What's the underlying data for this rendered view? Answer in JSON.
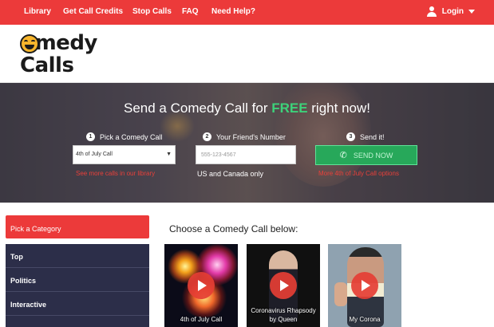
{
  "nav": {
    "links": [
      "Library",
      "Get Call Credits",
      "Stop Calls",
      "FAQ",
      "Need Help?"
    ],
    "login_label": "Login"
  },
  "logo": {
    "line1": "medy",
    "line2": "Calls",
    "first_letter": "C"
  },
  "hero": {
    "title_before": "Send a Comedy Call for ",
    "title_free": "FREE",
    "title_after": " right now!",
    "steps": [
      {
        "num": "1",
        "label": "Pick a Comedy Call"
      },
      {
        "num": "2",
        "label": "Your Friend's Number"
      },
      {
        "num": "3",
        "label": "Send it!"
      }
    ],
    "selected_call": "4th of July Call",
    "phone_placeholder": "555-123-4567",
    "send_label": "SEND NOW",
    "see_more_link": "See more calls in our library",
    "region_note": "US and Canada only",
    "more_options_link": "More 4th of July Call options"
  },
  "sidebar": {
    "header": "Pick a Category",
    "items": [
      "Top",
      "Politics",
      "Interactive"
    ]
  },
  "main": {
    "title": "Choose a Comedy Call below:",
    "cards": [
      {
        "caption": "4th of July Call"
      },
      {
        "caption": "Coronavirus Rhapsody by Queen"
      },
      {
        "caption": "My Corona"
      }
    ]
  },
  "colors": {
    "brand_red": "#ec3a3a",
    "free_green": "#3dd27a",
    "send_green": "#27a85a",
    "sidebar_navy": "#2c2e49"
  },
  "icons": [
    "user-icon",
    "chevron-down-icon",
    "phone-icon",
    "play-icon"
  ]
}
